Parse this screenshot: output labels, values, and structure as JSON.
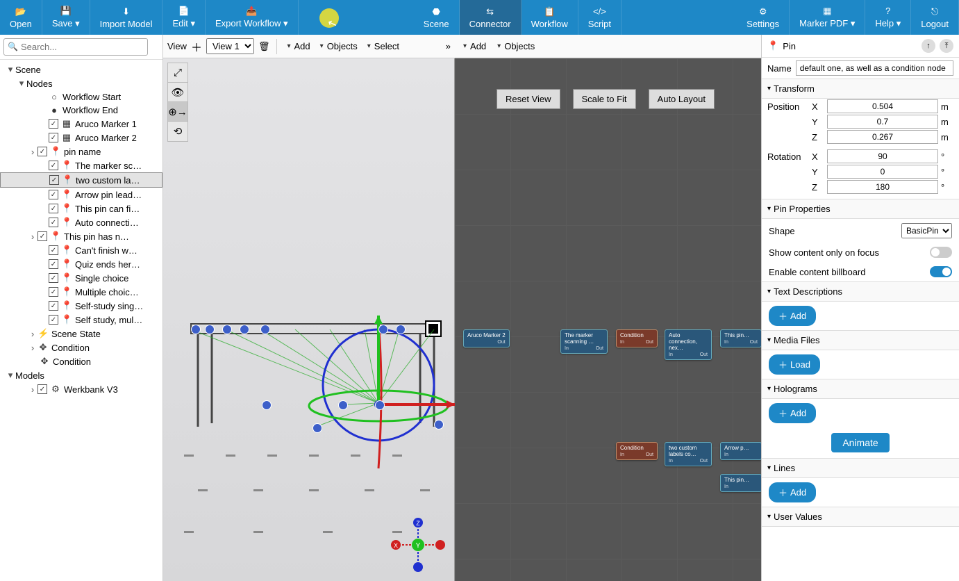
{
  "toolbar": {
    "open": "Open",
    "save": "Save",
    "import": "Import Model",
    "edit": "Edit",
    "export": "Export Workflow",
    "scene": "Scene",
    "connector": "Connector",
    "workflow": "Workflow",
    "script": "Script",
    "settings": "Settings",
    "marker": "Marker PDF",
    "help": "Help",
    "logout": "Logout"
  },
  "search": {
    "placeholder": "Search..."
  },
  "tree": {
    "scene": "Scene",
    "nodes": "Nodes",
    "items": [
      {
        "label": "Workflow Start",
        "icon": "○"
      },
      {
        "label": "Workflow End",
        "icon": "●"
      },
      {
        "label": "Aruco Marker 1",
        "icon": "▦",
        "cb": true
      },
      {
        "label": "Aruco Marker 2",
        "icon": "▦",
        "cb": true
      },
      {
        "label": "pin name",
        "icon": "📍",
        "cb": true,
        "exp": true
      },
      {
        "label": "The marker sc…",
        "icon": "📍",
        "cb": true
      },
      {
        "label": "two custom la…",
        "icon": "📍",
        "cb": true,
        "sel": true
      },
      {
        "label": "Arrow pin lead…",
        "icon": "📍",
        "cb": true
      },
      {
        "label": "This pin can fi…",
        "icon": "📍",
        "cb": true
      },
      {
        "label": "Auto connecti…",
        "icon": "📍",
        "cb": true
      },
      {
        "label": "This pin has n…",
        "icon": "📍",
        "cb": true,
        "exp": true
      },
      {
        "label": "Can't finish  w…",
        "icon": "📍",
        "cb": true
      },
      {
        "label": "Quiz ends her…",
        "icon": "📍",
        "cb": true
      },
      {
        "label": "Single choice",
        "icon": "📍",
        "cb": true
      },
      {
        "label": "Multiple choic…",
        "icon": "📍",
        "cb": true
      },
      {
        "label": "Self-study sing…",
        "icon": "📍",
        "cb": true
      },
      {
        "label": "Self study, mul…",
        "icon": "📍",
        "cb": true
      }
    ],
    "sceneState": "Scene State",
    "condition": "Condition",
    "models": "Models",
    "model1": "Werkbank V3"
  },
  "subbar": {
    "view": "View",
    "viewSel": "View 1",
    "add": "Add",
    "objects": "Objects",
    "select": "Select"
  },
  "connBar": {
    "add": "Add",
    "objects": "Objects"
  },
  "connBtns": {
    "reset": "Reset View",
    "scale": "Scale to Fit",
    "auto": "Auto Layout"
  },
  "nodes": {
    "a": "Aruco Marker 2",
    "b": "The marker scanning …",
    "c": "Condition",
    "d": "Auto connection, nex…",
    "e": "This pin…",
    "f": "Condition",
    "g": "two custom labels co…",
    "h": "Arrow p…",
    "i": "This pin…",
    "in": "In",
    "out": "Out"
  },
  "panel": {
    "title": "Pin",
    "nameLabel": "Name",
    "nameValue": "default one, as well as a condition node",
    "transform": "Transform",
    "position": "Position",
    "rotation": "Rotation",
    "px": "0.504",
    "py": "0.7",
    "pz": "0.267",
    "rx": "90",
    "ry": "0",
    "rz": "180",
    "m": "m",
    "deg": "°",
    "x": "X",
    "y": "Y",
    "z": "Z",
    "pinProps": "Pin Properties",
    "shape": "Shape",
    "shapeVal": "BasicPin",
    "focus": "Show content only on focus",
    "billboard": "Enable content billboard",
    "textDesc": "Text Descriptions",
    "add": "Add",
    "media": "Media Files",
    "load": "Load",
    "holo": "Holograms",
    "animate": "Animate",
    "lines": "Lines",
    "userValues": "User Values"
  }
}
